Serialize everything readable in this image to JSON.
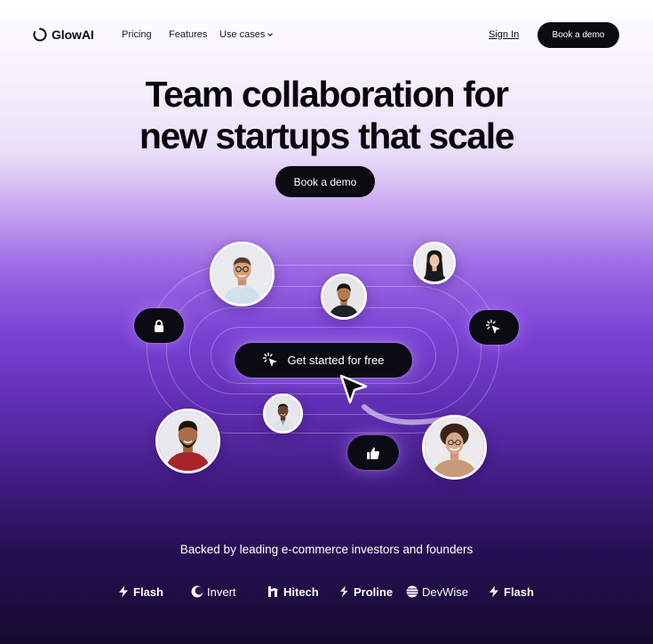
{
  "nav": {
    "brand": "GlowAI",
    "links": [
      "Pricing",
      "Features",
      "Use cases"
    ],
    "signin": "Sign In",
    "cta": "Book a demo"
  },
  "hero": {
    "title_line1": "Team collaboration for",
    "title_line2": "new startups that scale",
    "cta": "Book a demo"
  },
  "illustration": {
    "main_cta": "Get started for free",
    "pills": [
      "lock-icon",
      "cursor-click-icon",
      "thumbs-up-icon"
    ]
  },
  "backed": {
    "text": "Backed by leading e-commerce investors and founders",
    "logos": [
      {
        "name": "Flash",
        "icon": "bolt-icon"
      },
      {
        "name": "Invert",
        "icon": "crescent-icon"
      },
      {
        "name": "Hitech",
        "icon": "h-mark-icon"
      },
      {
        "name": "Proline",
        "icon": "bolt-icon"
      },
      {
        "name": "DevWise",
        "icon": "globe-lines-icon"
      },
      {
        "name": "Flash",
        "icon": "bolt-icon"
      }
    ]
  },
  "colors": {
    "ink": "#0b0b10",
    "purple": "#7a42d4",
    "deep": "#160a30",
    "white": "#ffffff"
  }
}
